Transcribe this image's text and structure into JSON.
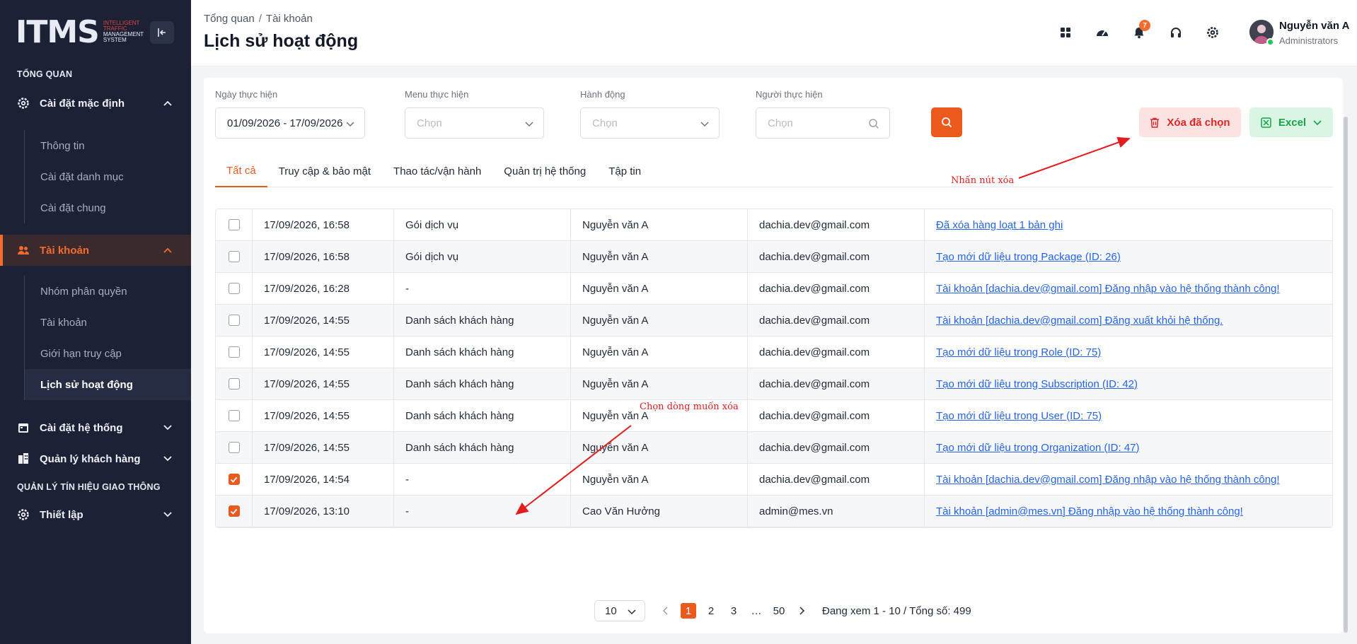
{
  "sidebar": {
    "logo_text": "ITMS",
    "logo_tagline": [
      "INTELLIGENT",
      "TRAFFIC",
      "MANAGEMENT",
      "SYSTEM"
    ],
    "section_overview": "TỔNG QUAN",
    "section_traffic": "QUẢN LÝ TÍN HIỆU GIAO THÔNG",
    "groups": [
      {
        "label": "Cài đặt mặc định",
        "icon": "gear-icon",
        "expanded": true
      },
      {
        "label": "Tài khoản",
        "icon": "users-icon",
        "expanded": true,
        "active": true
      },
      {
        "label": "Cài đặt hệ thống",
        "icon": "calendar-icon",
        "expanded": false
      },
      {
        "label": "Quản lý khách hàng",
        "icon": "building-icon",
        "expanded": false
      },
      {
        "label": "Thiết lập",
        "icon": "gear-icon",
        "expanded": false
      }
    ],
    "default_settings_items": [
      "Thông tin",
      "Cài đặt danh mục",
      "Cài đặt chung"
    ],
    "account_items": [
      "Nhóm phân quyền",
      "Tài khoản",
      "Giới hạn truy cập",
      "Lịch sử hoạt động"
    ]
  },
  "header": {
    "breadcrumb": [
      "Tổng quan",
      "Tài khoản"
    ],
    "title": "Lịch sử hoạt động",
    "notification_count": "7",
    "user_name": "Nguyễn văn A",
    "user_role": "Administrators"
  },
  "filters": {
    "date_label": "Ngày thực hiện",
    "date_value": "01/09/2026 - 17/09/2026",
    "menu_label": "Menu thực hiện",
    "menu_placeholder": "Chọn",
    "action_label": "Hành động",
    "action_placeholder": "Chọn",
    "person_label": "Người thực hiện",
    "person_placeholder": "Chọn",
    "delete_label": "Xóa đã chọn",
    "excel_label": "Excel"
  },
  "tabs": [
    "Tất cả",
    "Truy cập & bảo mật",
    "Thao tác/vận hành",
    "Quản trị hệ thống",
    "Tập tin"
  ],
  "annotations": {
    "delete_hint": "Nhấn nút xóa",
    "select_hint": "Chọn dòng muốn xóa"
  },
  "rows": [
    {
      "checked": false,
      "time": "17/09/2026, 16:58",
      "menu": "Gói dịch vụ",
      "user": "Nguyễn văn A",
      "email": "dachia.dev@gmail.com",
      "action": "Đã xóa hàng loạt 1 bản ghi"
    },
    {
      "checked": false,
      "time": "17/09/2026, 16:58",
      "menu": "Gói dịch vụ",
      "user": "Nguyễn văn A",
      "email": "dachia.dev@gmail.com",
      "action": "Tạo mới dữ liệu trong Package (ID: 26)"
    },
    {
      "checked": false,
      "time": "17/09/2026, 16:28",
      "menu": "-",
      "user": "Nguyễn văn A",
      "email": "dachia.dev@gmail.com",
      "action": "Tài khoản [dachia.dev@gmail.com] Đăng nhập vào hệ thống thành công!"
    },
    {
      "checked": false,
      "time": "17/09/2026, 14:55",
      "menu": "Danh sách khách hàng",
      "user": "Nguyễn văn A",
      "email": "dachia.dev@gmail.com",
      "action": "Tài khoản [dachia.dev@gmail.com] Đăng xuất khỏi hệ thống."
    },
    {
      "checked": false,
      "time": "17/09/2026, 14:55",
      "menu": "Danh sách khách hàng",
      "user": "Nguyễn văn A",
      "email": "dachia.dev@gmail.com",
      "action": "Tạo mới dữ liệu trong Role (ID: 75)"
    },
    {
      "checked": false,
      "time": "17/09/2026, 14:55",
      "menu": "Danh sách khách hàng",
      "user": "Nguyễn văn A",
      "email": "dachia.dev@gmail.com",
      "action": "Tạo mới dữ liệu trong Subscription (ID: 42)"
    },
    {
      "checked": false,
      "time": "17/09/2026, 14:55",
      "menu": "Danh sách khách hàng",
      "user": "Nguyễn văn A",
      "email": "dachia.dev@gmail.com",
      "action": "Tạo mới dữ liệu trong User (ID: 75)"
    },
    {
      "checked": false,
      "time": "17/09/2026, 14:55",
      "menu": "Danh sách khách hàng",
      "user": "Nguyễn văn A",
      "email": "dachia.dev@gmail.com",
      "action": "Tạo mới dữ liệu trong Organization (ID: 47)"
    },
    {
      "checked": true,
      "time": "17/09/2026, 14:54",
      "menu": "-",
      "user": "Nguyễn văn A",
      "email": "dachia.dev@gmail.com",
      "action": "Tài khoản [dachia.dev@gmail.com] Đăng nhập vào hệ thống thành công!"
    },
    {
      "checked": true,
      "time": "17/09/2026, 13:10",
      "menu": "-",
      "user": "Cao Văn Hưởng",
      "email": "admin@mes.vn",
      "action": "Tài khoản [admin@mes.vn] Đăng nhập vào hệ thống thành công!"
    }
  ],
  "pagination": {
    "page_size": "10",
    "pages": [
      "1",
      "2",
      "3",
      "…",
      "50"
    ],
    "current": "1",
    "info": "Đang xem 1 - 10 / Tổng số: 499"
  },
  "colors": {
    "accent": "#ea5a1d",
    "sidebar": "#1c2136",
    "link": "#2563eb",
    "danger": "#dc2626",
    "success": "#16a34a"
  }
}
